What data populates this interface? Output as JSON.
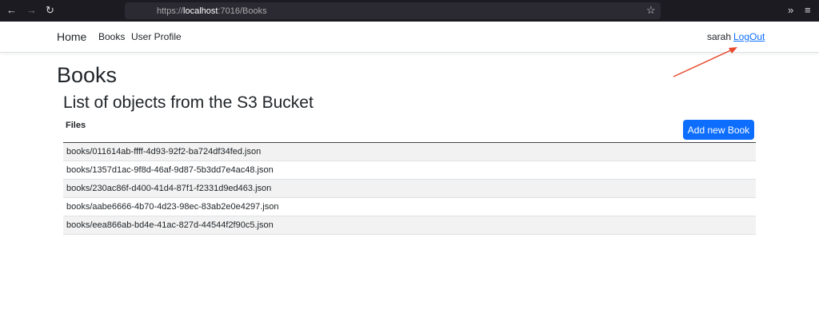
{
  "browser": {
    "url_prefix": "https://",
    "url_host": "localhost",
    "url_rest": ":7016/Books"
  },
  "nav": {
    "brand": "Home",
    "links": [
      "Books",
      "User Profile"
    ],
    "user": "sarah",
    "logout": "LogOut"
  },
  "page": {
    "title": "Books",
    "subtitle": "List of objects from the S3 Bucket",
    "column": "Files",
    "add_button": "Add new Book",
    "files": [
      "books/011614ab-ffff-4d93-92f2-ba724df34fed.json",
      "books/1357d1ac-9f8d-46af-9d87-5b3dd7e4ac48.json",
      "books/230ac86f-d400-41d4-87f1-f2331d9ed463.json",
      "books/aabe6666-4b70-4d23-98ec-83ab2e0e4297.json",
      "books/eea866ab-bd4e-41ac-827d-44544f2f90c5.json"
    ]
  }
}
